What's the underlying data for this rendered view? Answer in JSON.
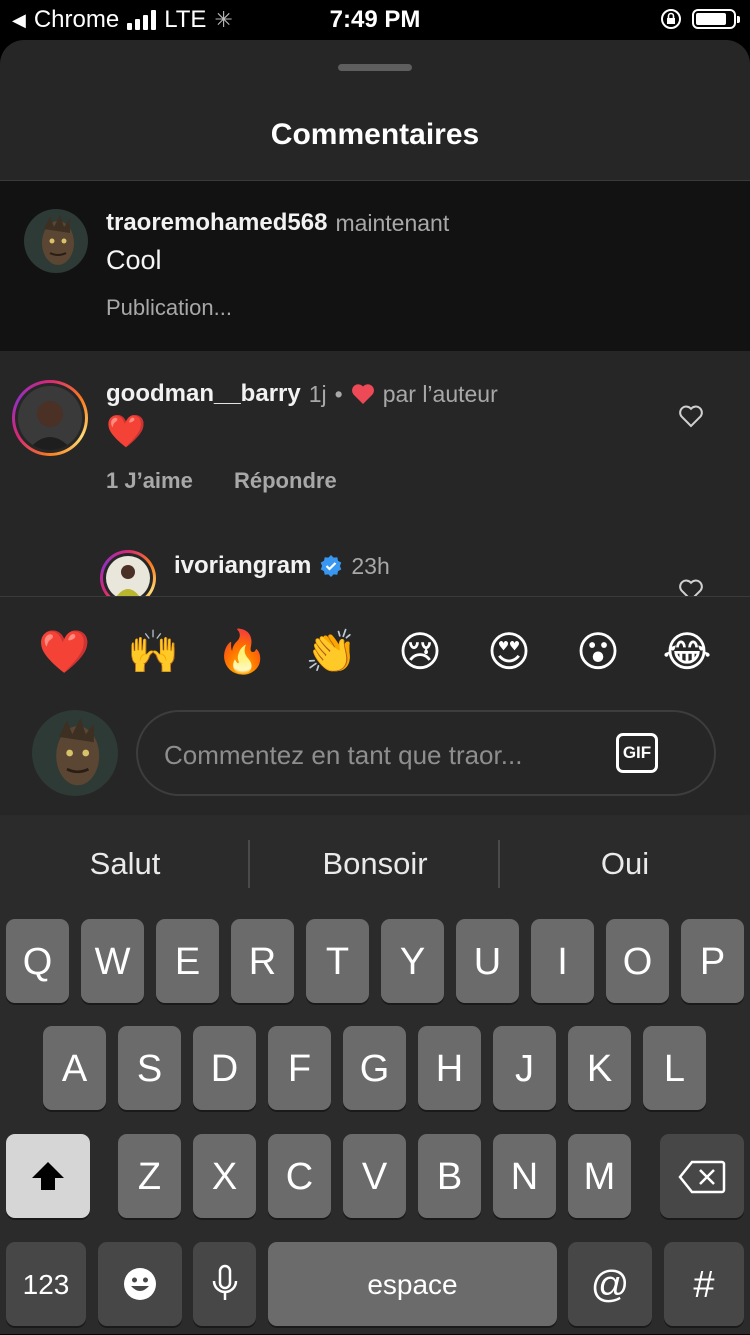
{
  "status_bar": {
    "back_app": "Chrome",
    "network": "LTE",
    "time": "7:49 PM",
    "battery_level": 0.85
  },
  "sheet": {
    "title": "Commentaires"
  },
  "own_comment": {
    "username": "traoremohamed568",
    "time": "maintenant",
    "text": "Cool",
    "status": "Publication..."
  },
  "comments": [
    {
      "username": "goodman__barry",
      "time": "1j",
      "separator": "•",
      "liked_by_author": "par l’auteur",
      "text": "❤️",
      "likes": "1 J’aime",
      "reply": "Répondre"
    },
    {
      "username": "ivoriangram",
      "verified": true,
      "time": "23h"
    }
  ],
  "reactions": [
    "❤️",
    "🙌",
    "🔥",
    "👏",
    "😢",
    "😍",
    "😮",
    "😂"
  ],
  "composer": {
    "placeholder": "Commentez en tant que traor...",
    "gif_label": "GIF"
  },
  "keyboard": {
    "suggestions": [
      "Salut",
      "Bonsoir",
      "Oui"
    ],
    "row1": [
      "Q",
      "W",
      "E",
      "R",
      "T",
      "Y",
      "U",
      "I",
      "O",
      "P"
    ],
    "row2": [
      "A",
      "S",
      "D",
      "F",
      "G",
      "H",
      "J",
      "K",
      "L"
    ],
    "row3": [
      "Z",
      "X",
      "C",
      "V",
      "B",
      "N",
      "M"
    ],
    "numbers_key": "123",
    "space_key": "espace",
    "at_key": "@",
    "hash_key": "#"
  },
  "colors": {
    "sheet_bg": "#262626",
    "own_comment_bg": "#121212",
    "keyboard_bg": "#2b2b2b",
    "heart_red": "#ed4956",
    "verified_blue": "#3897f0"
  }
}
